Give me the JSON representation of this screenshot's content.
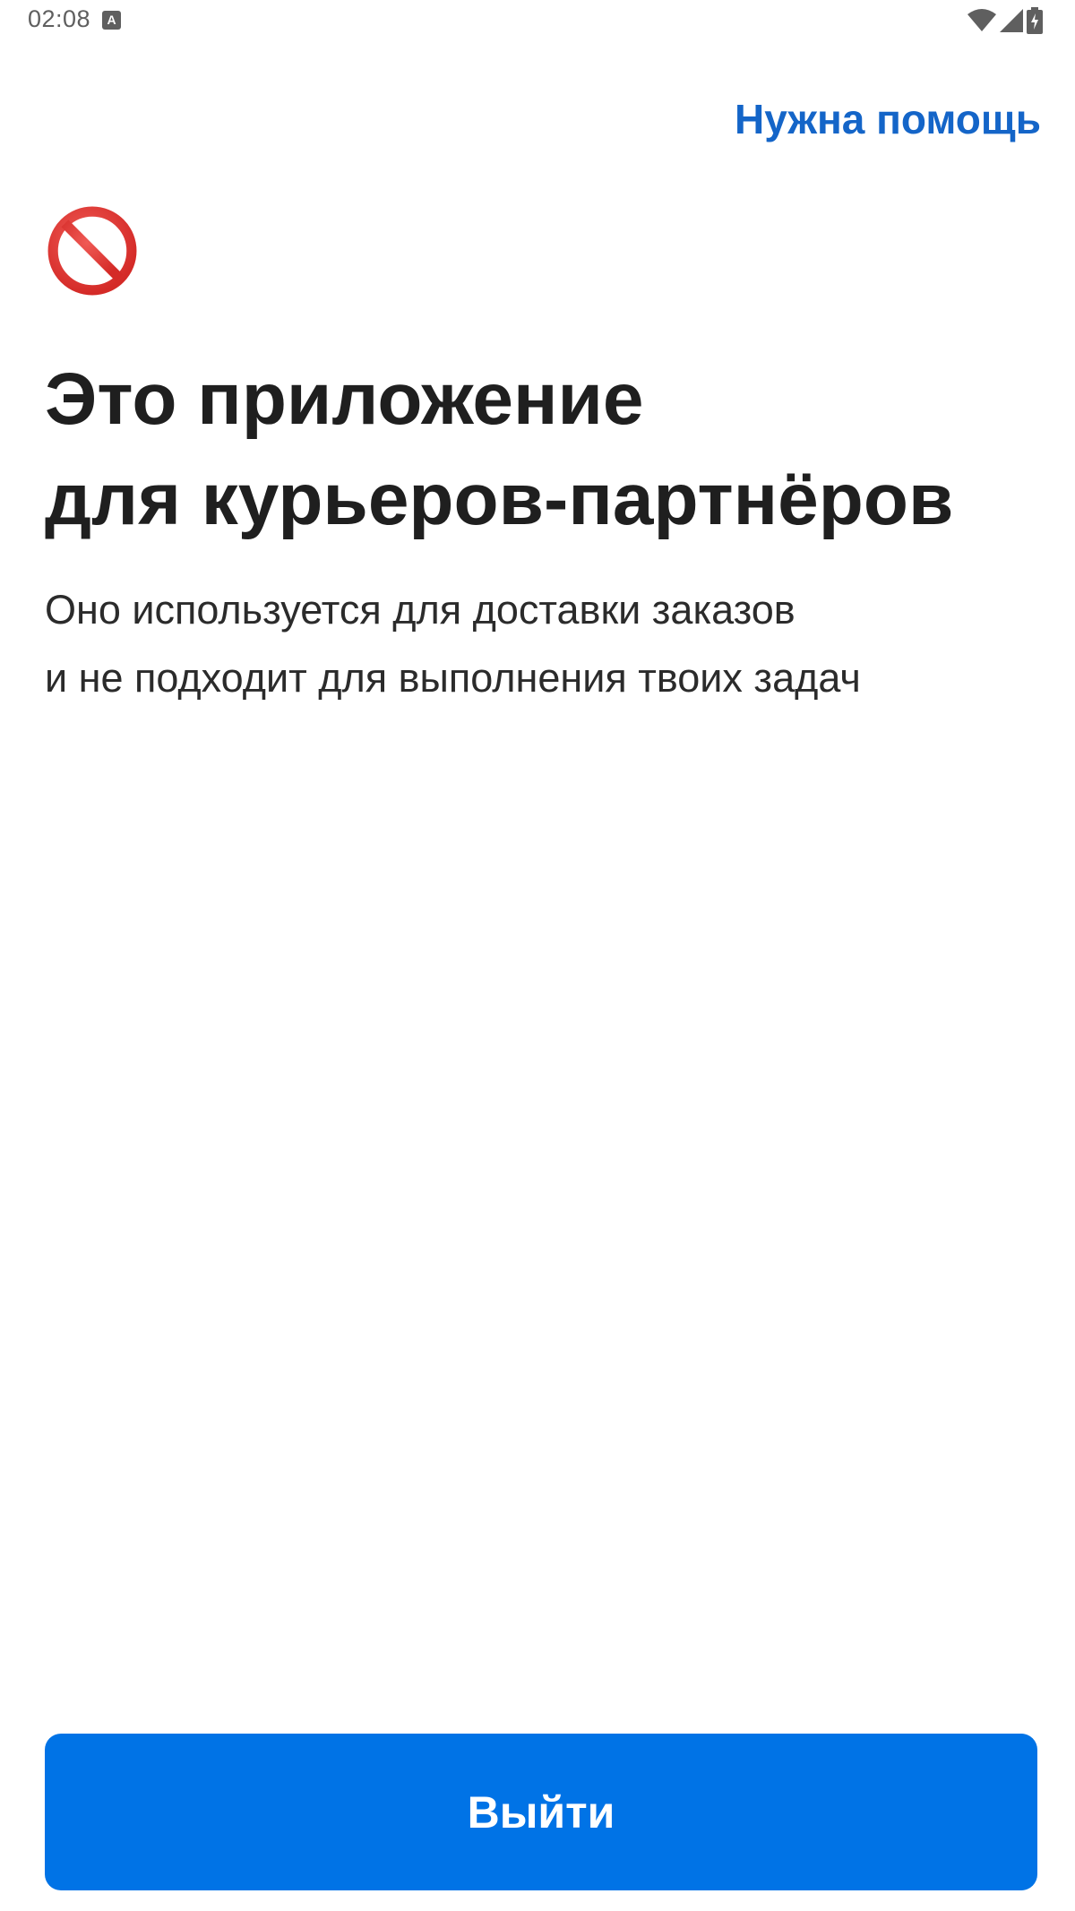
{
  "status_bar": {
    "time": "02:08",
    "notification_icon_letter": "A",
    "icons": [
      "wifi-icon",
      "cellular-signal-icon",
      "battery-charging-icon"
    ]
  },
  "header": {
    "help_link": "Нужна помощь"
  },
  "content": {
    "icon": "prohibited-icon",
    "title_lines": [
      "Это приложение",
      "для курьеров-партнёров"
    ],
    "subtitle_lines": [
      "Оно используется для доставки заказов",
      "и не подходит для выполнения твоих задач"
    ]
  },
  "footer": {
    "exit_button_label": "Выйти"
  },
  "colors": {
    "accent_link": "#1465c8",
    "primary_button": "#0073e6",
    "prohibited_red": "#e0312f",
    "text": "#1f1f1f"
  }
}
